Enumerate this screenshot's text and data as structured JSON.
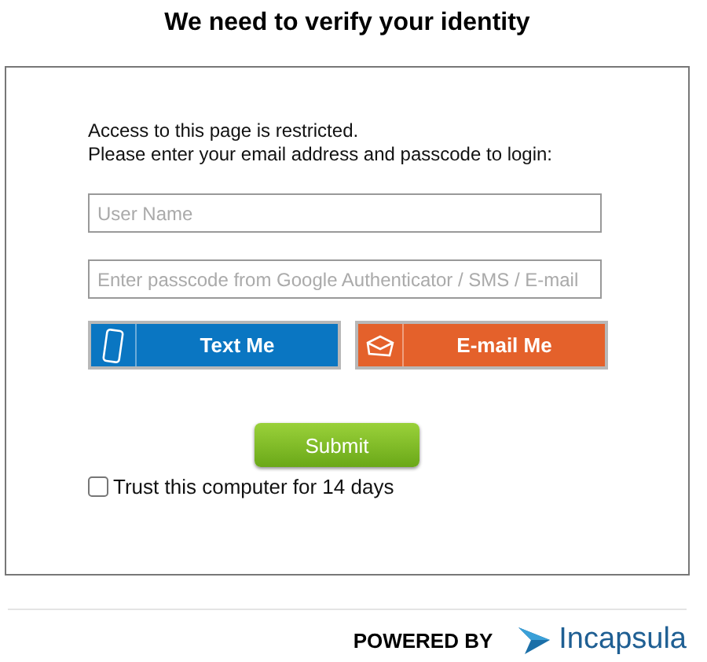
{
  "title": "We need to verify your identity",
  "intro": [
    "Access to this page is restricted.",
    "Please enter your email address and passcode to login:"
  ],
  "fields": [
    {
      "placeholder": "User Name"
    },
    {
      "placeholder": "Enter passcode from Google Authenticator / SMS / E-mail"
    }
  ],
  "methods": [
    {
      "kind": "phone",
      "label": "Text Me",
      "color": "#0a76c2"
    },
    {
      "kind": "mail",
      "label": "E-mail Me",
      "color": "#e4612b"
    }
  ],
  "submit": "Submit",
  "trust": {
    "label": "Trust this computer for 14 days",
    "checked": false
  },
  "footer": {
    "powered": "POWERED BY",
    "brand": "Incapsula"
  }
}
